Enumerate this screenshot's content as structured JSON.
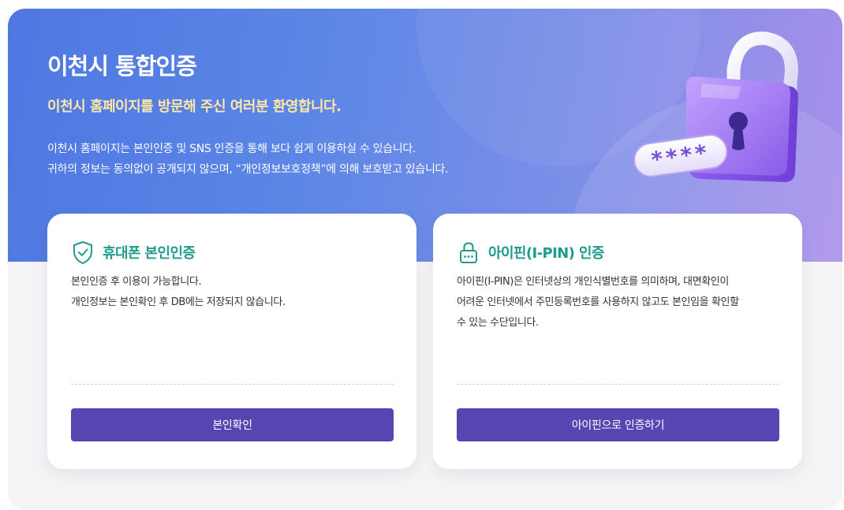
{
  "hero": {
    "title": "이천시 통합인증",
    "welcome": "이천시 홈페이지를 방문해 주신 여러분 환영합니다.",
    "description": [
      "이천시 홈페이지는 본인인증 및 SNS 인증을 통해 보다 쉽게 이용하실 수 있습니다.",
      "귀하의 정보는 동의없이 공개되지 않으며, “개인정보보호정책”에 의해 보호받고 있습니다."
    ],
    "illustration": {
      "icon": "padlock-icon",
      "password_mask": "****"
    }
  },
  "cards": [
    {
      "icon": "shield-check-icon",
      "title": "휴대폰 본인인증",
      "body": [
        "본인인증 후 이용이 가능합니다.",
        "개인정보는 본인확인 후 DB에는 저장되지 않습니다."
      ],
      "button": "본인확인"
    },
    {
      "icon": "lock-icon",
      "title": "아이핀(I-PIN) 인증",
      "body": [
        "아이핀(I-PIN)은 인터넷상의 개인식별번호를 의미하며, 대면확인이",
        "어려운 인터넷에서 주민등록번호를 사용하지 않고도 본인임을 확인할",
        "수 있는 수단입니다."
      ],
      "button": "아이핀으로 인증하기"
    }
  ],
  "colors": {
    "hero_gradient_start": "#4f77e2",
    "hero_gradient_end": "#a98fea",
    "welcome_text": "#ffe7a6",
    "card_title": "#1f9b8d",
    "button": "#5546b2",
    "lock_body": "#9b6cf0"
  }
}
